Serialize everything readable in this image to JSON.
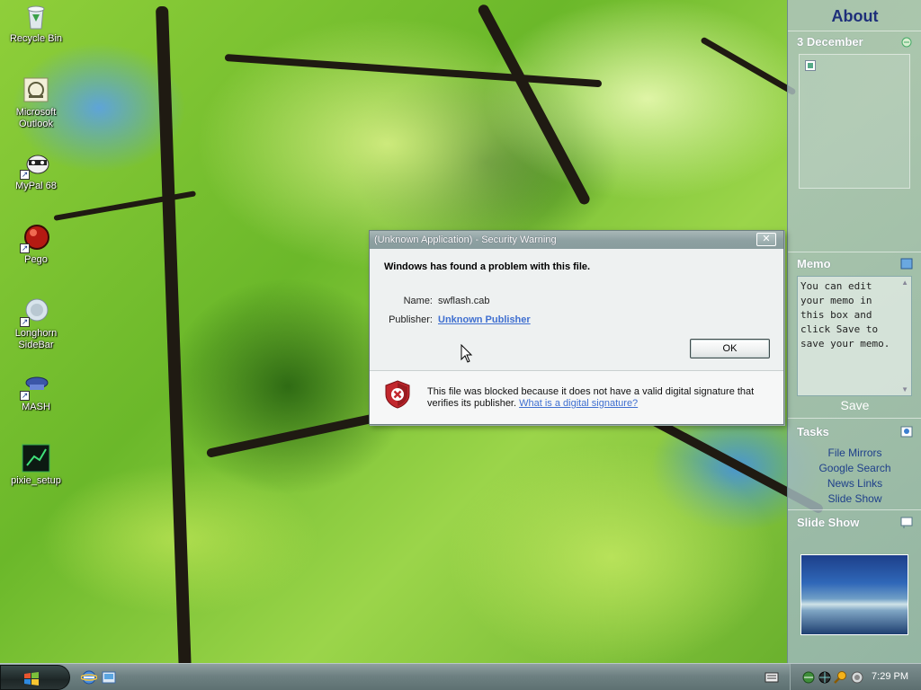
{
  "desktop": {
    "icons": [
      {
        "label": "Recycle Bin",
        "icon": "recycle-bin-icon"
      },
      {
        "label": "Microsoft Outlook",
        "icon": "outlook-icon"
      },
      {
        "label": "MyPal 68",
        "icon": "mypal-icon"
      },
      {
        "label": "Pego",
        "icon": "pego-icon"
      },
      {
        "label": "Longhorn SideBar",
        "icon": "longhorn-sidebar-icon"
      },
      {
        "label": "MASH",
        "icon": "mash-icon"
      },
      {
        "label": "pixie_setup",
        "icon": "pixie-icon"
      }
    ]
  },
  "dialog": {
    "title": "(Unknown Application) - Security Warning",
    "close_label": "✕",
    "heading": "Windows has found a problem with this file.",
    "name_label": "Name:",
    "name_value": "swflash.cab",
    "publisher_label": "Publisher:",
    "publisher_value": "Unknown Publisher",
    "ok_label": "OK",
    "footer_text": "This file was blocked because it does not have a valid digital signature that verifies its publisher.",
    "footer_link": "What is a digital signature?"
  },
  "sidebar": {
    "about": "About",
    "date": "3 December",
    "memo_title": "Memo",
    "memo_text": "You can edit your memo in this box and click Save to save your memo.",
    "save_label": "Save",
    "tasks_title": "Tasks",
    "tasks": [
      "File Mirrors",
      "Google Search",
      "News Links",
      "Slide Show"
    ],
    "slideshow_title": "Slide Show"
  },
  "taskbar": {
    "clock": "7:29 PM",
    "colors": {
      "accent": "#3f6fd0",
      "shield": "#c2272d"
    }
  }
}
